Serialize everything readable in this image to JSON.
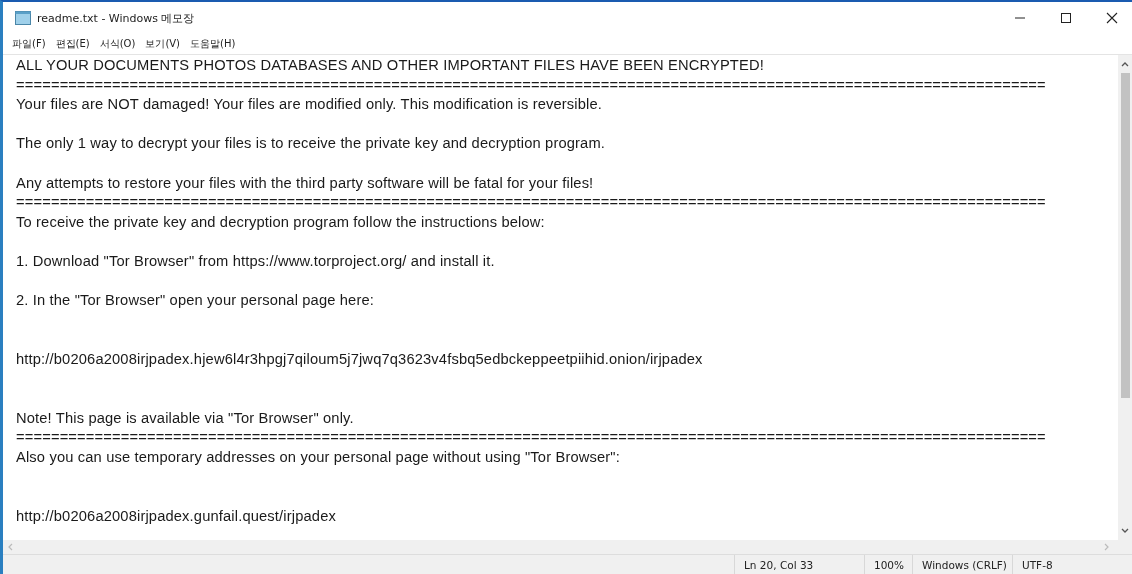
{
  "window": {
    "title": "readme.txt - Windows 메모장"
  },
  "menu": [
    "파일(F)",
    "편집(E)",
    "서식(O)",
    "보기(V)",
    "도움말(H)"
  ],
  "document": {
    "lines": [
      {
        "kind": "text",
        "text": "ALL YOUR DOCUMENTS PHOTOS DATABASES AND OTHER IMPORTANT FILES HAVE BEEN ENCRYPTED!"
      },
      {
        "kind": "text",
        "text": "======================================================================================================================"
      },
      {
        "kind": "text",
        "text": "Your files are NOT damaged! Your files are modified only. This modification is reversible."
      },
      {
        "kind": "blank"
      },
      {
        "kind": "text",
        "text": "The only 1 way to decrypt your files is to receive the private key and decryption program."
      },
      {
        "kind": "blank"
      },
      {
        "kind": "text",
        "text": "Any attempts to restore your files with the third party software will be fatal for your files!"
      },
      {
        "kind": "text",
        "text": "======================================================================================================================"
      },
      {
        "kind": "text",
        "text": "To receive the private key and decryption program follow the instructions below:"
      },
      {
        "kind": "blank"
      },
      {
        "kind": "text",
        "text": "1. Download \"Tor Browser\" from https://www.torproject.org/ and install it."
      },
      {
        "kind": "blank"
      },
      {
        "kind": "text",
        "text": "2. In the \"Tor Browser\" open your personal page here:"
      },
      {
        "kind": "blank"
      },
      {
        "kind": "blank"
      },
      {
        "kind": "text",
        "text": "http://b0206a2008irjpadex.hjew6l4r3hpgj7qiloum5j7jwq7q3623v4fsbq5edbckeppeetpiihid.onion/irjpadex"
      },
      {
        "kind": "blank"
      },
      {
        "kind": "blank"
      },
      {
        "kind": "text",
        "text": "Note! This page is available via \"Tor Browser\" only."
      },
      {
        "kind": "text",
        "text": "======================================================================================================================"
      },
      {
        "kind": "text",
        "text": "Also you can use temporary addresses on your personal page without using \"Tor Browser\":"
      },
      {
        "kind": "blank"
      },
      {
        "kind": "blank"
      },
      {
        "kind": "text",
        "text": "http://b0206a2008irjpadex.gunfail.quest/irjpadex"
      }
    ]
  },
  "status_bar": {
    "position": "Ln 20, Col 33",
    "zoom": "100%",
    "line_ending": "Windows (CRLF)",
    "encoding": "UTF-8"
  }
}
